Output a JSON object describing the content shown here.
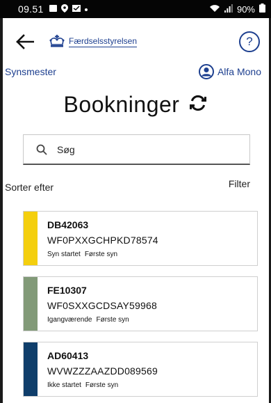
{
  "status_bar": {
    "time": "09.51",
    "battery": "90%"
  },
  "header": {
    "brand_name": "Færdselsstyrelsen",
    "help_symbol": "?"
  },
  "subheader": {
    "role": "Synsmester",
    "user_name": "Alfa Mono"
  },
  "page": {
    "title": "Bookninger"
  },
  "search": {
    "placeholder": "Søg"
  },
  "sort": {
    "label": "Sorter efter",
    "filter_label": "Filter"
  },
  "bookings": [
    {
      "plate": "DB42063",
      "vin": "WF0PXXGCHPKD78574",
      "status": "Syn startet",
      "type": "Første syn",
      "color": "#f4cf0e"
    },
    {
      "plate": "FE10307",
      "vin": "WF0SXXGCDSAY59968",
      "status": "Igangværende",
      "type": "Første syn",
      "color": "#829a78"
    },
    {
      "plate": "AD60413",
      "vin": "WVWZZZAAZDD089569",
      "status": "Ikke startet",
      "type": "Første syn",
      "color": "#0f3e6b"
    }
  ],
  "colors": {
    "brand": "#1d3f8f",
    "status_bar": "#050505"
  }
}
